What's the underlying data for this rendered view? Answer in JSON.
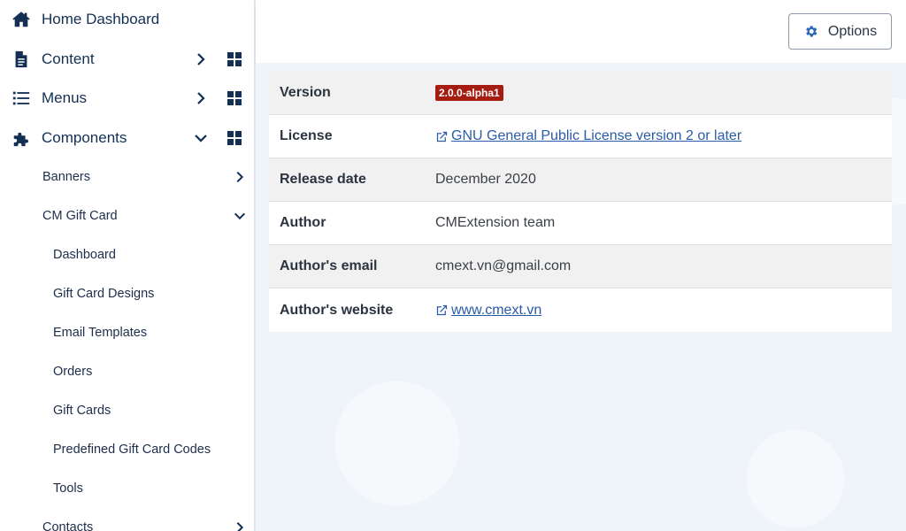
{
  "sidebar": {
    "top_items": [
      {
        "label": "Home Dashboard",
        "icon": "home-icon"
      },
      {
        "label": "Content",
        "icon": "file-icon"
      },
      {
        "label": "Menus",
        "icon": "list-icon"
      },
      {
        "label": "Components",
        "icon": "puzzle-icon"
      }
    ],
    "components": {
      "banners": "Banners",
      "cm_gift_card": "CM Gift Card",
      "contacts": "Contacts"
    },
    "gift_card_items": [
      "Dashboard",
      "Gift Card Designs",
      "Email Templates",
      "Orders",
      "Gift Cards",
      "Predefined Gift Card Codes",
      "Tools"
    ]
  },
  "header": {
    "options_label": "Options"
  },
  "info": {
    "version": {
      "key": "Version",
      "value": "2.0.0-alpha1"
    },
    "license": {
      "key": "License",
      "value": "GNU General Public License version 2 or later"
    },
    "release_date": {
      "key": "Release date",
      "value": "December 2020"
    },
    "author": {
      "key": "Author",
      "value": "CMExtension team"
    },
    "author_email": {
      "key": "Author's email",
      "value": "cmext.vn@gmail.com"
    },
    "author_website": {
      "key": "Author's website",
      "value": "www.cmext.vn"
    }
  },
  "colors": {
    "nav_text": "#132f53",
    "badge_bg": "#a51d12",
    "link": "#2a5ba8",
    "accent": "#2a69b8"
  }
}
